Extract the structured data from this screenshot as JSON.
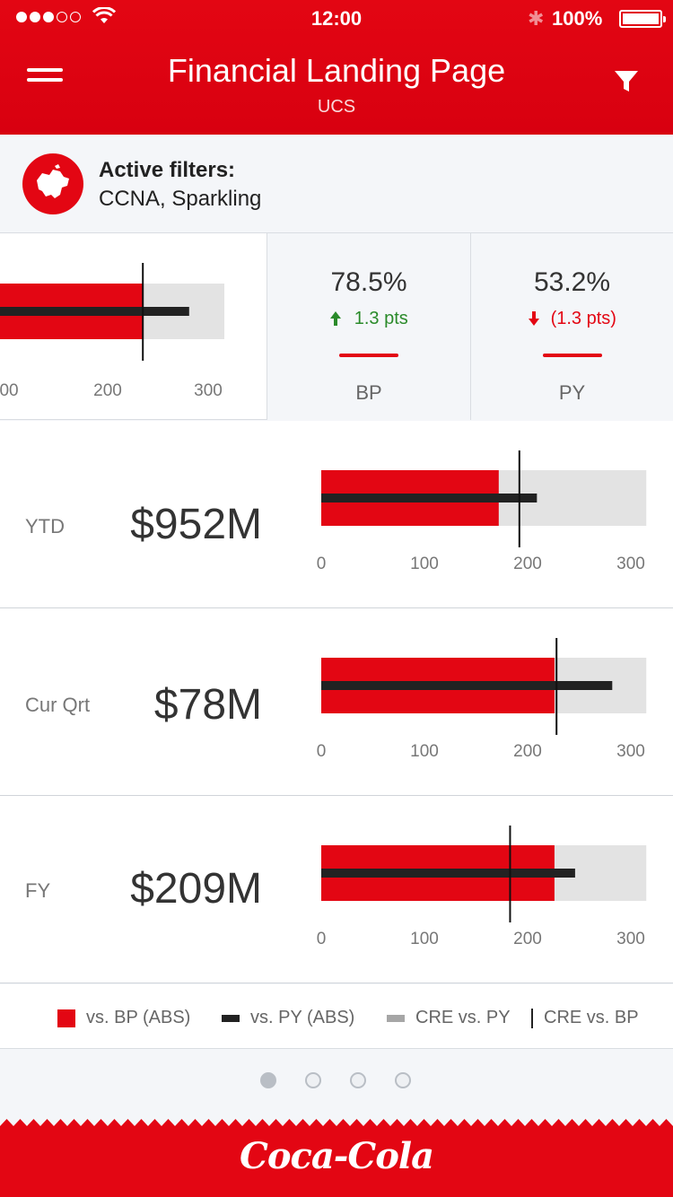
{
  "status_bar": {
    "time": "12:00",
    "battery": "100%"
  },
  "header": {
    "title": "Financial Landing Page",
    "subtitle": "UCS"
  },
  "filters": {
    "label": "Active filters:",
    "value": "CCNA, Sparkling"
  },
  "kpis": [
    {
      "value": "78.5%",
      "delta": "1.3 pts",
      "direction": "up",
      "label": "BP"
    },
    {
      "value": "53.2%",
      "delta": "(1.3 pts)",
      "direction": "down",
      "label": "PY"
    }
  ],
  "axis_ticks": [
    "0",
    "100",
    "200",
    "300"
  ],
  "top_partial_chart": {
    "visible_tick_labels": [
      "00",
      "200",
      "300"
    ],
    "bp": 235,
    "py": 290,
    "bp_marker": 235,
    "range_max": 310
  },
  "metrics": [
    {
      "label": "YTD",
      "value": "$952M"
    },
    {
      "label": "Cur Qrt",
      "value": "$78M"
    },
    {
      "label": "FY",
      "value": "$209M"
    }
  ],
  "chart_data": [
    {
      "type": "bar",
      "title": "YTD",
      "xlim": [
        0,
        300
      ],
      "series": [
        {
          "name": "vs. BP (ABS)",
          "values": [
            172
          ]
        },
        {
          "name": "vs. PY (ABS)",
          "values": [
            209
          ]
        },
        {
          "name": "CRE vs. PY",
          "values": [
            315
          ]
        },
        {
          "name": "CRE vs. BP",
          "values": [
            192
          ]
        }
      ]
    },
    {
      "type": "bar",
      "title": "Cur Qrt",
      "xlim": [
        0,
        300
      ],
      "series": [
        {
          "name": "vs. BP (ABS)",
          "values": [
            226
          ]
        },
        {
          "name": "vs. PY (ABS)",
          "values": [
            282
          ]
        },
        {
          "name": "CRE vs. PY",
          "values": [
            315
          ]
        },
        {
          "name": "CRE vs. BP",
          "values": [
            228
          ]
        }
      ]
    },
    {
      "type": "bar",
      "title": "FY",
      "xlim": [
        0,
        300
      ],
      "series": [
        {
          "name": "vs. BP (ABS)",
          "values": [
            226
          ]
        },
        {
          "name": "vs. PY (ABS)",
          "values": [
            246
          ]
        },
        {
          "name": "CRE vs. PY",
          "values": [
            315
          ]
        },
        {
          "name": "CRE vs. BP",
          "values": [
            183
          ]
        }
      ]
    }
  ],
  "legend": [
    "vs. BP (ABS)",
    "vs. PY (ABS)",
    "CRE vs. PY",
    "CRE vs. BP"
  ],
  "colors": {
    "brand_red": "#e30613",
    "py_bar": "#222222",
    "range_grey": "#e3e3e3",
    "up": "#2a8a2a",
    "down": "#e30613"
  },
  "pager": {
    "count": 4,
    "active": 0
  },
  "footer": {
    "brand": "Coca-Cola"
  }
}
